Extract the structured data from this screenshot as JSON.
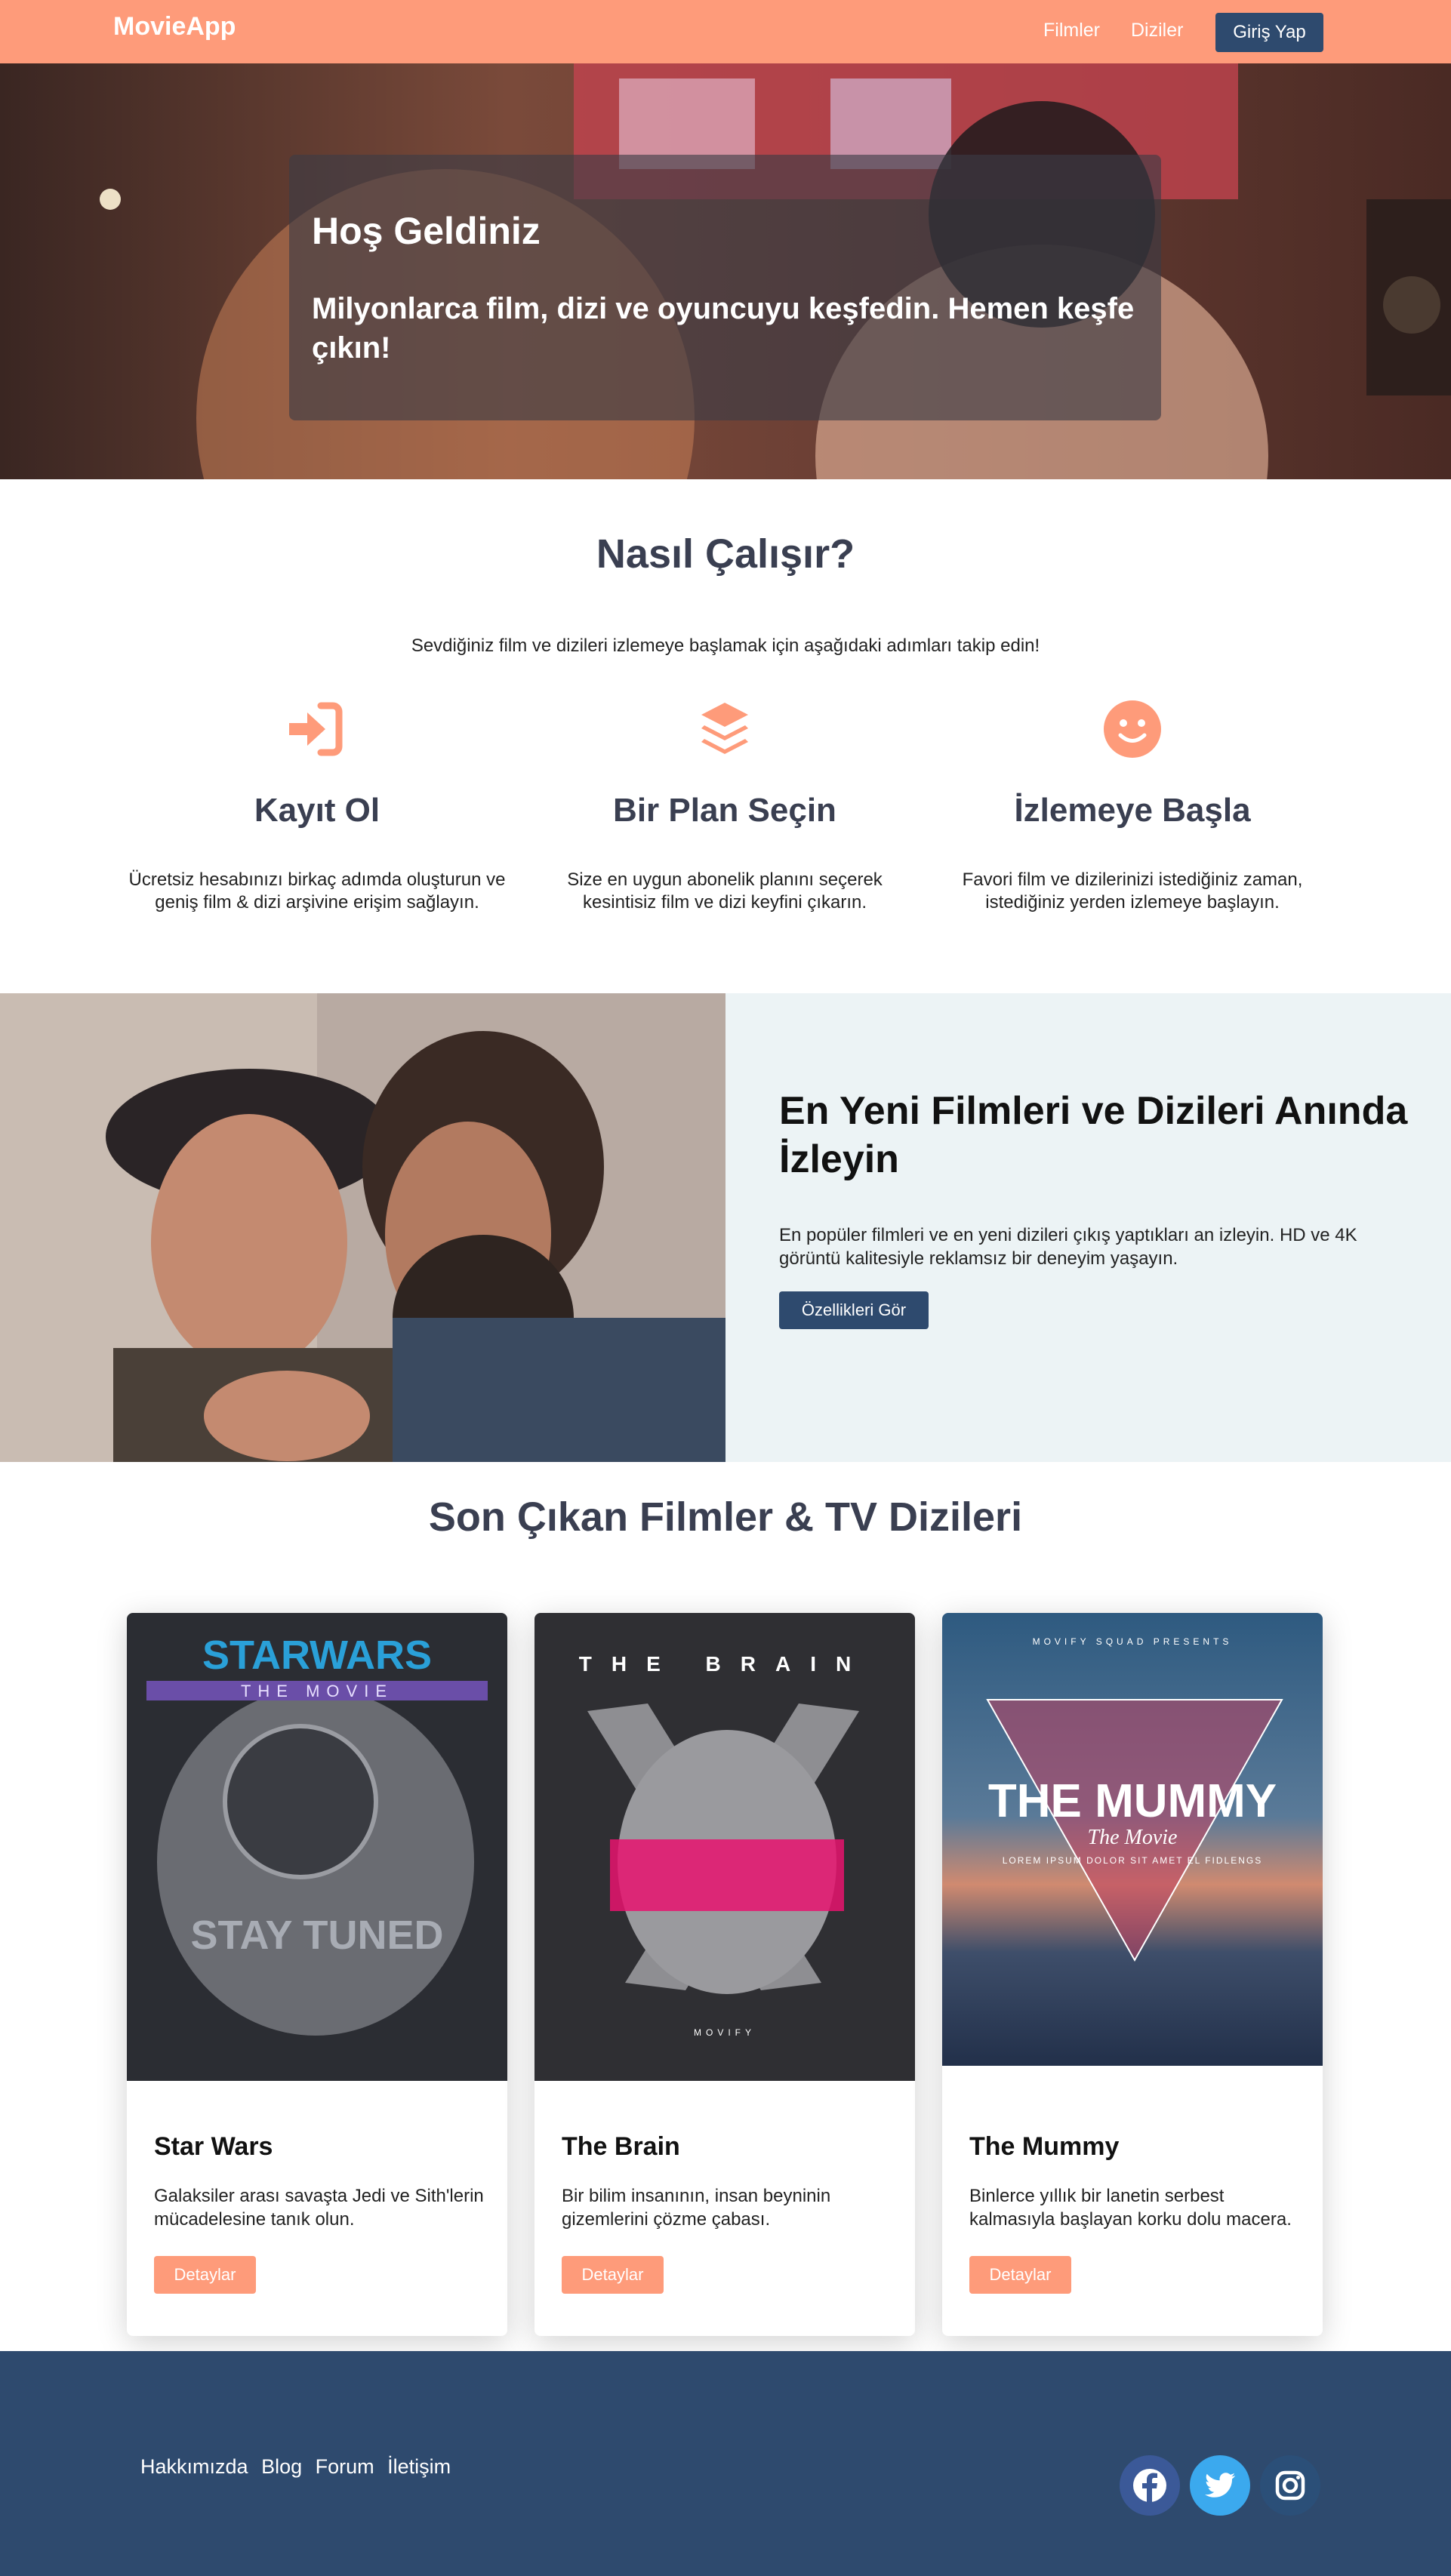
{
  "navbar": {
    "brand": "MovieApp",
    "links": [
      "Filmler",
      "Diziler"
    ],
    "login_label": "Giriş Yap"
  },
  "hero": {
    "title": "Hoş Geldiniz",
    "subtitle": "Milyonlarca film, dizi ve oyuncuyu keşfedin. Hemen keşfe çıkın!"
  },
  "how": {
    "title": "Nasıl Çalışır?",
    "subtitle": "Sevdiğiniz film ve dizileri izlemeye başlamak için aşağıdaki adımları takip edin!",
    "steps": [
      {
        "icon": "sign-in-icon",
        "title": "Kayıt Ol",
        "text": "Ücretsiz hesabınızı birkaç adımda oluşturun ve geniş film & dizi arşivine erişim sağlayın."
      },
      {
        "icon": "layers-icon",
        "title": "Bir Plan Seçin",
        "text": "Size en uygun abonelik planını seçerek kesintisiz film ve dizi keyfini çıkarın."
      },
      {
        "icon": "smile-icon",
        "title": "İzlemeye Başla",
        "text": "Favori film ve dizilerinizi istediğiniz zaman, istediğiniz yerden izlemeye başlayın."
      }
    ]
  },
  "feature": {
    "title": "En Yeni Filmleri ve Dizileri Anında İzleyin",
    "text": "En popüler filmleri ve en yeni dizileri çıkış yaptıkları an izleyin. HD ve 4K görüntü kalitesiyle reklamsız bir deneyim yaşayın.",
    "button_label": "Özellikleri Gör"
  },
  "latest": {
    "title": "Son Çıkan Filmler & TV Dizileri",
    "cards": [
      {
        "title": "Star Wars",
        "text": "Galaksiler arası savaşta Jedi ve Sith'lerin mücadelesine tanık olun.",
        "button_label": "Detaylar",
        "poster_text": [
          "STARWARS",
          "THE MOVIE",
          "STAY TUNED"
        ]
      },
      {
        "title": "The Brain",
        "text": "Bir bilim insanının, insan beyninin gizemlerini çözme çabası.",
        "button_label": "Detaylar",
        "poster_text": [
          "THE BRAIN",
          "MOVIFY"
        ]
      },
      {
        "title": "The Mummy",
        "text": "Binlerce yıllık bir lanetin serbest kalmasıyla başlayan korku dolu macera.",
        "button_label": "Detaylar",
        "poster_text": [
          "MOVIFY SQUAD PRESENTS",
          "THE MUMMY",
          "The Movie",
          "LOREM IPSUM DOLOR SIT AMET EL FIDLENGS"
        ]
      }
    ]
  },
  "footer": {
    "links": [
      "Hakkımızda",
      "Blog",
      "Forum",
      "İletişim"
    ],
    "social": [
      "facebook-icon",
      "twitter-icon",
      "instagram-icon"
    ]
  },
  "colors": {
    "accent": "#fe9b7a",
    "navy": "#2e4a6e",
    "heading": "#3a3f51",
    "panel": "#ecf3f5"
  }
}
